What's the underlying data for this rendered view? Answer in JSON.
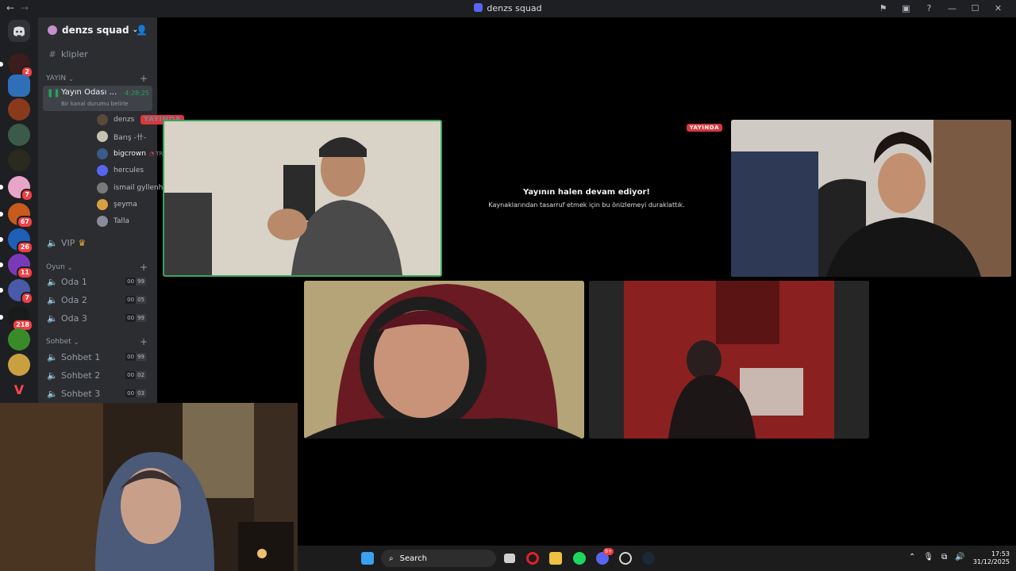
{
  "window": {
    "title": "denzs squad"
  },
  "server": {
    "name": "denzs squad"
  },
  "rail_badges": [
    "2",
    "7",
    "67",
    "26",
    "11",
    "7",
    "218"
  ],
  "channels": {
    "text": {
      "name": "klipler"
    },
    "categories": [
      {
        "label": "YAYIN"
      },
      {
        "label": "Oyun"
      },
      {
        "label": "Sohbet"
      }
    ],
    "stream_room": {
      "name": "Yayın Odası ...",
      "timer": "4:28:25",
      "status_hint": "Bir kanal durumu belirle"
    },
    "vip": {
      "name": "VIP"
    },
    "voice": [
      {
        "name": "Oda 1",
        "count": "00",
        "limit": "99"
      },
      {
        "name": "Oda 2",
        "count": "00",
        "limit": "05"
      },
      {
        "name": "Oda 3",
        "count": "00",
        "limit": "99"
      },
      {
        "name": "Sohbet 1",
        "count": "00",
        "limit": "99"
      },
      {
        "name": "Sohbet 2",
        "count": "00",
        "limit": "02"
      },
      {
        "name": "Sohbet 3",
        "count": "00",
        "limit": "03"
      }
    ]
  },
  "voice_users": [
    {
      "name": "denzs",
      "live": "YAYINDA"
    },
    {
      "name": "Barış -卄-"
    },
    {
      "name": "bigcrown",
      "tag": "TRC"
    },
    {
      "name": "hercules"
    },
    {
      "name": "ismail gyllenhaal"
    },
    {
      "name": "şeyma"
    },
    {
      "name": "Talla"
    }
  ],
  "stage": {
    "live_badge": "YAYINDA",
    "paused_title": "Yayının halen devam ediyor!",
    "paused_sub": "Kaynaklarından tasarruf etmek için bu önizlemeyi duraklattık."
  },
  "taskbar": {
    "search": "Search",
    "time": "17:53",
    "date": "31/12/2025",
    "badge": "9+"
  },
  "colors": {
    "speaking_border": "#3ba55c",
    "live_red": "#da373c",
    "sidebar_bg": "#2b2d31",
    "rail_bg": "#1e1f22"
  }
}
